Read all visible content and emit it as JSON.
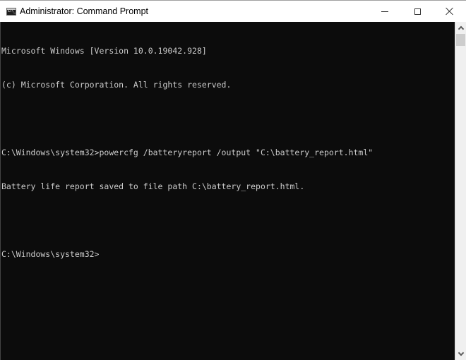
{
  "window": {
    "title": "Administrator: Command Prompt",
    "icon": "command-prompt-icon",
    "icon_glyph": "C:\\_",
    "controls": {
      "minimize": "minimize-icon",
      "maximize": "maximize-icon",
      "close": "close-icon"
    }
  },
  "console": {
    "background": "#0c0c0c",
    "foreground": "#cccccc",
    "lines": [
      "Microsoft Windows [Version 10.0.19042.928]",
      "(c) Microsoft Corporation. All rights reserved.",
      "",
      "C:\\Windows\\system32>powercfg /batteryreport /output \"C:\\battery_report.html\"",
      "Battery life report saved to file path C:\\battery_report.html.",
      "",
      "C:\\Windows\\system32>"
    ]
  },
  "scrollbar": {
    "up_icon": "chevron-up-icon",
    "down_icon": "chevron-down-icon"
  }
}
